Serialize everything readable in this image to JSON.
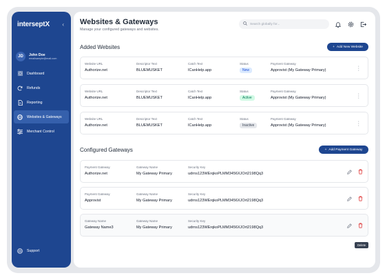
{
  "app": {
    "logo_prefix": "intersept",
    "logo_suffix": "X"
  },
  "user": {
    "initials": "JD",
    "name": "John Doe",
    "email": "emailsample@mail.com"
  },
  "sidebar": {
    "items": [
      {
        "label": "Dashboard",
        "icon": "grid-icon",
        "active": false
      },
      {
        "label": "Refunds",
        "icon": "refresh-icon",
        "active": false
      },
      {
        "label": "Reporting",
        "icon": "file-icon",
        "active": false
      },
      {
        "label": "Websites & Gateways",
        "icon": "globe-icon",
        "active": true
      },
      {
        "label": "Merchant Control",
        "icon": "sliders-icon",
        "active": false
      }
    ],
    "support_label": "Support"
  },
  "header": {
    "title": "Websites & Gateways",
    "subtitle": "Manage your configured gateways and websites.",
    "search_placeholder": "Search globally for..."
  },
  "websites": {
    "section_title": "Added Websites",
    "add_button": "Add New Website",
    "labels": {
      "url": "Website URL",
      "descriptor": "Descriptor Text",
      "catch": "Catch Text",
      "status": "Status",
      "gateway": "Payment Gateway"
    },
    "rows": [
      {
        "url": "Authorize.net",
        "descriptor": "BLUEMUSKET",
        "catch": "ICanHelp.app",
        "status": "New",
        "gateway": "Approvist (My Gateway Primary)"
      },
      {
        "url": "Authorize.net",
        "descriptor": "BLUEMUSKET",
        "catch": "ICanHelp.app",
        "status": "Active",
        "gateway": "Approvist (My Gateway Primary)"
      },
      {
        "url": "Authorize.net",
        "descriptor": "BLUEMUSKET",
        "catch": "ICanHelp.app",
        "status": "Inactive",
        "gateway": "Approvist (My Gateway Primary)"
      }
    ]
  },
  "gateways": {
    "section_title": "Configured Gateways",
    "add_button": "Add Payment Gateway",
    "labels": {
      "gateway": "Payment Gateway",
      "gateway_alt": "Gateway Name",
      "name": "Gateway Name",
      "key": "Security Key"
    },
    "rows": [
      {
        "col1_label": "Payment Gateway",
        "col1": "Authorize.net",
        "name": "My Gateway Primary",
        "key": "udrns123WErqkoPLMM3456XJOrt2198Qq3"
      },
      {
        "col1_label": "Payment Gateway",
        "col1": "Approvist",
        "name": "My Gateway Primary",
        "key": "udrns123WErqkoPLMM3456XJOrt2198Qq3"
      },
      {
        "col1_label": "Gateway Name",
        "col1": "Gateway Name3",
        "name": "My Gateway Primary",
        "key": "udrns123WErqkoPLMM3456XJOrt2198Qq3"
      }
    ],
    "tooltip": "Delete"
  },
  "colors": {
    "brand": "#1e4690",
    "status_new_bg": "#dbeafe",
    "status_new_fg": "#1d4ed8",
    "status_active_bg": "#d1fae5",
    "status_active_fg": "#047857",
    "status_inactive_bg": "#e5e7eb",
    "status_inactive_fg": "#374151",
    "delete": "#dc2626"
  }
}
